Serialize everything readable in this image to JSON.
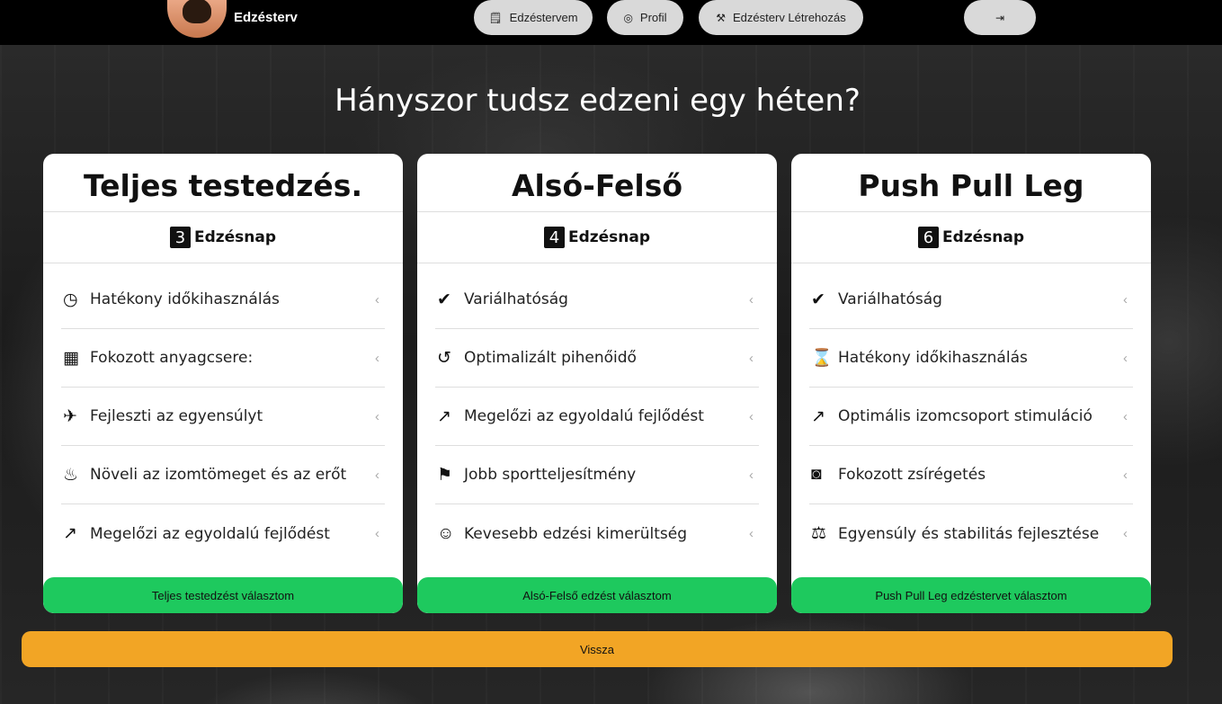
{
  "navbar": {
    "brand": "Edzésterv",
    "buttons": [
      {
        "label": "Edzéstervem",
        "icon": "clipboard-icon",
        "glyph": "🗒"
      },
      {
        "label": "Profil",
        "icon": "user-circle-icon",
        "glyph": "◎"
      },
      {
        "label": "Edzésterv Létrehozás",
        "icon": "dumbbell-icon",
        "glyph": "⚒"
      }
    ],
    "logout_glyph": "⇥"
  },
  "page": {
    "title": "Hányszor tudsz edzeni egy héten?"
  },
  "cards": [
    {
      "title": "Teljes testedzés.",
      "days": "3",
      "days_label": "Edzésnap",
      "items": [
        {
          "label": "Hatékony időkihasználás",
          "icon": "clock-icon",
          "glyph": "◷"
        },
        {
          "label": "Fokozott anyagcsere:",
          "icon": "scale-icon",
          "glyph": "▦"
        },
        {
          "label": "Fejleszti az egyensúlyt",
          "icon": "balance-figure-icon",
          "glyph": "✈"
        },
        {
          "label": "Növeli az izomtömeget és az erőt",
          "icon": "muscle-arm-icon",
          "glyph": "♨"
        },
        {
          "label": "Megelőzi az egyoldalú fejlődést",
          "icon": "growth-chart-icon",
          "glyph": "↗"
        }
      ],
      "button": "Teljes testedzést választom"
    },
    {
      "title": "Alsó-Felső",
      "days": "4",
      "days_label": "Edzésnap",
      "items": [
        {
          "label": "Variálhatóság",
          "icon": "double-check-icon",
          "glyph": "✔"
        },
        {
          "label": "Optimalizált pihenőidő",
          "icon": "rest-timer-icon",
          "glyph": "↺"
        },
        {
          "label": "Megelőzi az egyoldalú fejlődést",
          "icon": "growth-chart-icon",
          "glyph": "↗"
        },
        {
          "label": "Jobb sportteljesítmény",
          "icon": "weightlifter-icon",
          "glyph": "⚑"
        },
        {
          "label": "Kevesebb edzési kimerültség",
          "icon": "smile-icon",
          "glyph": "☺"
        }
      ],
      "button": "Alsó-Felső edzést választom"
    },
    {
      "title": "Push Pull Leg",
      "days": "6",
      "days_label": "Edzésnap",
      "items": [
        {
          "label": "Variálhatóság",
          "icon": "double-check-icon",
          "glyph": "✔"
        },
        {
          "label": "Hatékony időkihasználás",
          "icon": "hourglass-person-icon",
          "glyph": "⌛"
        },
        {
          "label": "Optimális izomcsoport stimuláció",
          "icon": "growth-chart-icon",
          "glyph": "↗"
        },
        {
          "label": "Fokozott zsírégetés",
          "icon": "body-scale-icon",
          "glyph": "◙"
        },
        {
          "label": "Egyensúly és stabilitás fejlesztése",
          "icon": "balance-scale-icon",
          "glyph": "⚖"
        }
      ],
      "button": "Push Pull Leg edzéstervet választom"
    }
  ],
  "back_button": "Vissza",
  "chevron": "‹",
  "colors": {
    "choose": "#1ec95e",
    "back": "#f2a525",
    "navbar": "#000000"
  }
}
